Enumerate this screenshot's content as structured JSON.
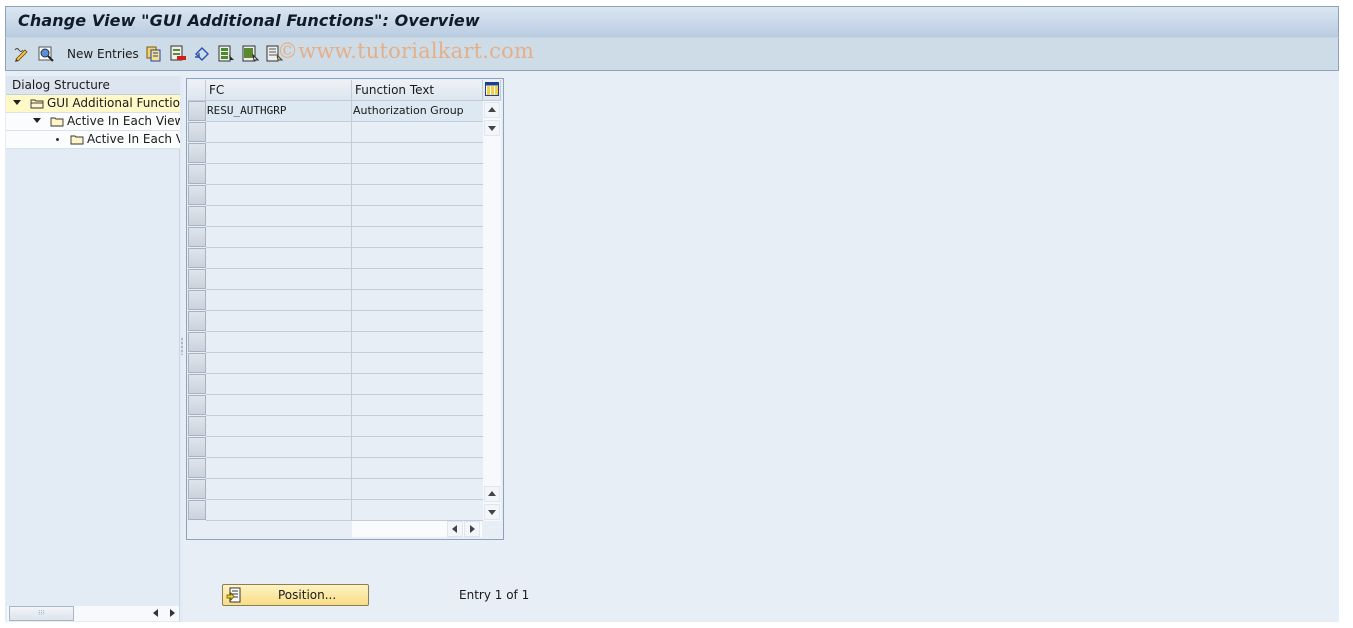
{
  "window": {
    "title": "Change View \"GUI Additional Functions\": Overview"
  },
  "toolbar": {
    "items": [
      {
        "icon": "display-change-icon",
        "tooltip": ""
      },
      {
        "icon": "details-icon",
        "tooltip": ""
      },
      {
        "label": "New Entries"
      },
      {
        "icon": "copy-as-icon"
      },
      {
        "icon": "delete-icon"
      },
      {
        "icon": "undo-change-icon"
      },
      {
        "icon": "select-all-icon"
      },
      {
        "icon": "select-block-icon"
      },
      {
        "icon": "deselect-all-icon"
      }
    ],
    "new_entries_label": "New Entries",
    "watermark": "©www.tutorialkart.com"
  },
  "dialog_structure": {
    "header": "Dialog Structure",
    "nodes": [
      {
        "label": "GUI Additional Functions",
        "level": 0,
        "expanded": true,
        "selected": true
      },
      {
        "label": "Active In Each View",
        "level": 1,
        "expanded": true,
        "selected": false
      },
      {
        "label": "Active In Each View",
        "level": 2,
        "expanded": false,
        "selected": false
      }
    ]
  },
  "table": {
    "columns": [
      "FC",
      "Function Text"
    ],
    "rows": [
      [
        "RESU_AUTHGRP",
        "Authorization Group"
      ]
    ],
    "visible_row_count": 20
  },
  "footer": {
    "position_button": "Position...",
    "entry_text": "Entry 1 of 1"
  },
  "colors": {
    "title_gradient_top": "#dbe6f2",
    "title_gradient_bottom": "#b9cce0",
    "selected_node": "#fff9c8",
    "button_yellow": "#f8dd86",
    "watermark": "#e8a878"
  }
}
